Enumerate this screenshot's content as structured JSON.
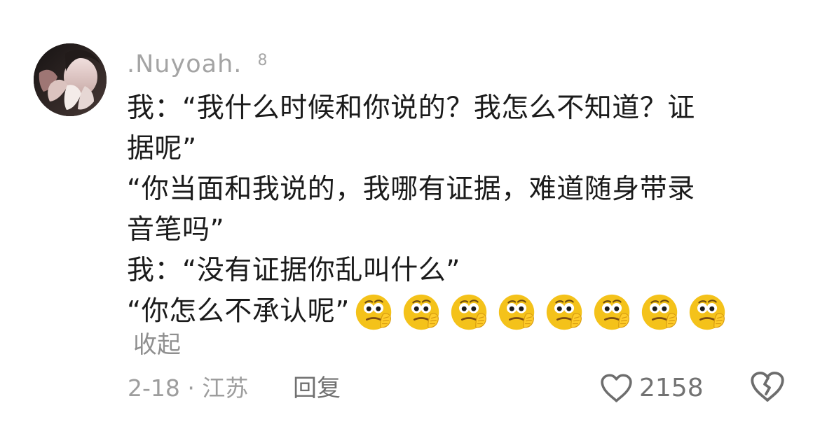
{
  "comment": {
    "username": ".Nuyoah.",
    "user_level": "8",
    "lines": [
      "我：“我什么时候和你说的？我怎么不知道？证",
      "据呢”",
      "“你当面和我说的，我哪有证据，难道随身带录",
      "音笔吗”",
      "我：“没有证据你乱叫什么”",
      "“你怎么不承认呢”"
    ],
    "emoji_icon": "thinking-face-emoji",
    "emoji_count": 8,
    "collapse_label": "收起",
    "meta_text": "2-18 · 江苏",
    "reply_label": "回复",
    "like_icon": "heart-outline-icon",
    "like_count": "2158",
    "dislike_icon": "broken-heart-outline-icon",
    "colors": {
      "username": "#a4a4a4",
      "body_text": "#1b1b1b",
      "meta_text": "#9d9d9d",
      "reply_text": "#707070",
      "emoji_face": "#f4c21a"
    }
  }
}
